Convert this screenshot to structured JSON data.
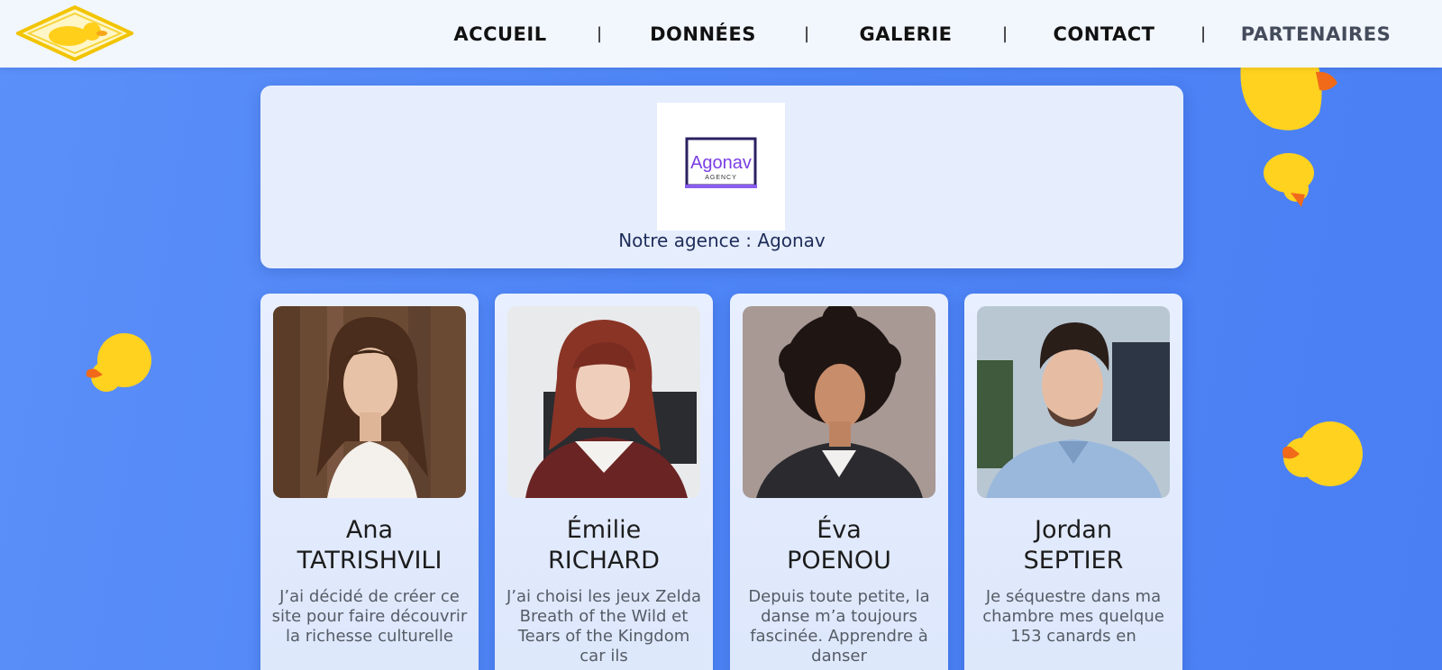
{
  "nav": {
    "logo_icon": "duck-diamond-logo-icon",
    "links": [
      {
        "label": "ACCUEIL"
      },
      {
        "label": "DONNÉES"
      },
      {
        "label": "GALERIE"
      },
      {
        "label": "CONTACT"
      },
      {
        "label": "PARTENAIRES"
      }
    ],
    "separator": "|"
  },
  "agency": {
    "logo_text": "Agonav",
    "logo_subtext": "AGENCY",
    "caption": "Notre agence : Agonav"
  },
  "members": [
    {
      "first_name": "Ana",
      "last_name": "TATRISHVILI",
      "description": "J’ai décidé de créer ce site pour faire découvrir la richesse culturelle"
    },
    {
      "first_name": "Émilie",
      "last_name": "RICHARD",
      "description": "J’ai choisi les jeux Zelda Breath of the Wild et Tears of the Kingdom car ils"
    },
    {
      "first_name": "Éva",
      "last_name": "POENOU",
      "description": "Depuis toute petite, la danse m’a toujours fascinée. Apprendre à danser"
    },
    {
      "first_name": "Jordan",
      "last_name": "SEPTIER",
      "description": "Je séquestre dans ma chambre mes quelque 153 canards en"
    }
  ],
  "colors": {
    "background": "#4f86f7",
    "nav_bg": "#f2f6fd",
    "duck_yellow": "#ffd21f",
    "duck_beak": "#f06a1a",
    "agency_purple": "#7b3fe4"
  }
}
